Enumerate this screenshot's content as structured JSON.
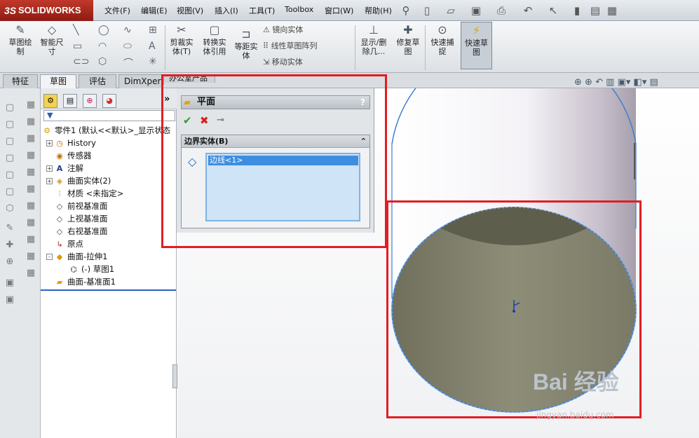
{
  "app": {
    "logo_prefix": "3S",
    "logo_text": "SOLIDWORKS"
  },
  "menu": [
    "文件(F)",
    "编辑(E)",
    "视图(V)",
    "插入(I)",
    "工具(T)",
    "Toolbox",
    "窗口(W)",
    "帮助(H)"
  ],
  "ribbon": {
    "sketch": "草图绘\n制",
    "smart_dim": "智能尺\n寸",
    "trim": "剪裁实\n体(T)",
    "convert": "转换实\n体引用",
    "offset": "等距实\n体",
    "mirror": "镜向实体",
    "linear_pattern": "线性草图阵列",
    "move": "移动实体",
    "display_delete": "显示/删\n除几...",
    "repair": "修复草\n图",
    "quick_snap": "快速捕\n捉",
    "rapid_sketch": "快速草\n图"
  },
  "tabs": [
    "特征",
    "草图",
    "评估",
    "DimXpert",
    "办公室产品"
  ],
  "featuremanager": {
    "filter_icon": "filter-icon",
    "items": [
      {
        "label": "零件1  (默认<<默认>_显示状态",
        "icon": "part-icon",
        "expand": ""
      },
      {
        "label": "History",
        "icon": "history-icon",
        "expand": "+"
      },
      {
        "label": "传感器",
        "icon": "sensor-icon",
        "expand": ""
      },
      {
        "label": "注解",
        "icon": "annotation-icon",
        "expand": "+"
      },
      {
        "label": "曲面实体(2)",
        "icon": "surface-bodies-icon",
        "expand": "+"
      },
      {
        "label": "材质 <未指定>",
        "icon": "material-icon",
        "expand": ""
      },
      {
        "label": "前视基准面",
        "icon": "plane-icon",
        "expand": ""
      },
      {
        "label": "上视基准面",
        "icon": "plane-icon",
        "expand": ""
      },
      {
        "label": "右视基准面",
        "icon": "plane-icon",
        "expand": ""
      },
      {
        "label": "原点",
        "icon": "origin-icon",
        "expand": ""
      },
      {
        "label": "曲面-拉伸1",
        "icon": "surface-extrude-icon",
        "expand": "-"
      },
      {
        "label": "(-) 草图1",
        "icon": "sketch-icon",
        "expand": ""
      },
      {
        "label": "曲面-基准面1",
        "icon": "planar-surface-icon",
        "expand": ""
      }
    ]
  },
  "property_manager": {
    "title": "平面",
    "help": "?",
    "collapse": "»",
    "group_title": "边界实体(B)",
    "selected_item": "边线<1>"
  },
  "watermark": {
    "brand": "Bai 经验",
    "url": "jingyan.baidu.com"
  },
  "colors": {
    "red_highlight": "#e21d23",
    "selection_blue": "#3d8ee0",
    "surface": "#7a7a66"
  }
}
